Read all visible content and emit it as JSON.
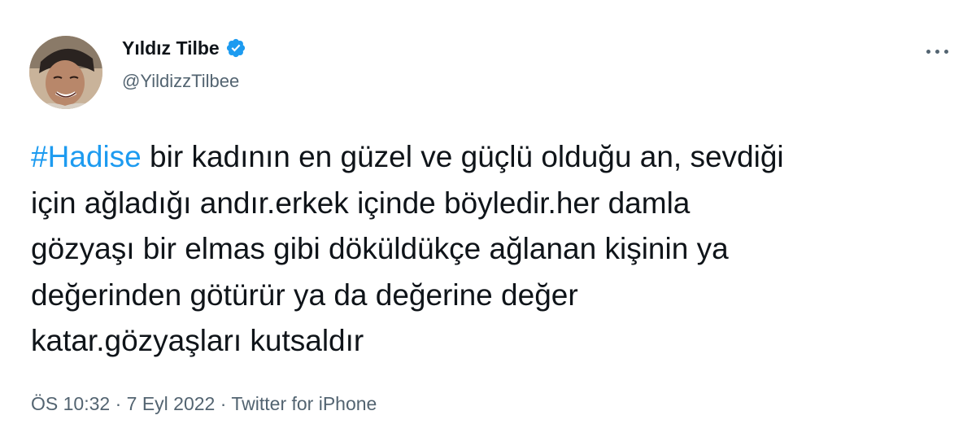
{
  "author": {
    "display_name": "Yıldız Tilbe",
    "handle": "@YildizzTilbee",
    "verified": true,
    "verified_badge_color": "#1d9bf0"
  },
  "tweet": {
    "hashtag": "#Hadise",
    "text_after_hashtag": " bir kadının en güzel ve güçlü olduğu an, sevdiği\niçin ağladığı andır.erkek içinde böyledir.her damla\ngözyaşı bir elmas gibi döküldükçe ağlanan kişinin ya\ndeğerinden götürür ya da değerine değer\nkatar.gözyaşları kutsaldır"
  },
  "meta": {
    "time": "ÖS 10:32",
    "separator": " · ",
    "date": "7 Eyl 2022",
    "source": "Twitter for iPhone"
  },
  "colors": {
    "text": "#0f1419",
    "secondary": "#536471",
    "link": "#1d9bf0"
  },
  "icons": {
    "more": "more-horizontal-icon",
    "verified": "verified-badge-icon"
  }
}
